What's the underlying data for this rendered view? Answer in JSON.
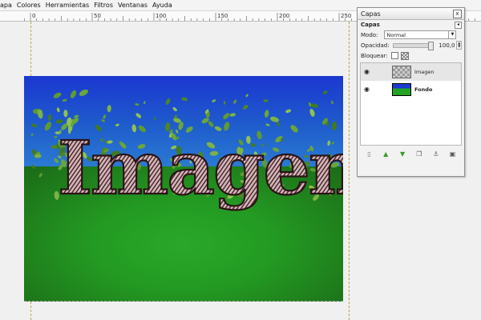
{
  "menu": {
    "items": [
      "apa",
      "Colores",
      "Herramientas",
      "Filtros",
      "Ventanas",
      "Ayuda"
    ]
  },
  "ruler": {
    "labels": [
      "0",
      "50",
      "100",
      "150",
      "200",
      "250"
    ]
  },
  "canvas": {
    "text_art": "Imagen",
    "colors": {
      "sky_top": "#1b37d0",
      "sky_bottom": "#2a7ad2",
      "grass": "#239a22",
      "letters": "#c9a5a8",
      "leaves": "#6aa63a"
    }
  },
  "layers_dialog": {
    "title": "Capas",
    "close": "x",
    "panel_title": "Capas",
    "mode_label": "Modo:",
    "mode_value": "Normal",
    "opacity_label": "Opacidad:",
    "opacity_value": "100,0",
    "opacity_fraction": 1.0,
    "lock_label": "Bloquear:",
    "layers": [
      {
        "name": "Imagen",
        "selected": true,
        "thumb": "checker"
      },
      {
        "name": "Fondo",
        "selected": false,
        "thumb": "bg"
      }
    ],
    "toolbar_icons": [
      "new-layer-icon",
      "raise-layer-icon",
      "lower-layer-icon",
      "duplicate-layer-icon",
      "anchor-layer-icon",
      "delete-layer-icon"
    ]
  }
}
